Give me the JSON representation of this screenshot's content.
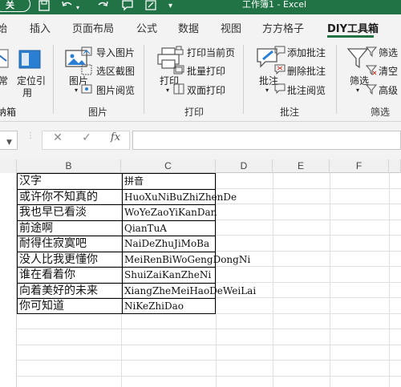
{
  "title_bar": {
    "autosave_label": "关",
    "document_title": "工作簿1 - Excel",
    "accent_color": "#217346",
    "icons": [
      "save-icon",
      "undo-icon",
      "redo-icon",
      "comment-icon",
      "dropdown-icon"
    ]
  },
  "tabs": [
    {
      "label": "始",
      "active": false
    },
    {
      "label": "插入",
      "active": false
    },
    {
      "label": "页面布局",
      "active": false
    },
    {
      "label": "公式",
      "active": false
    },
    {
      "label": "数据",
      "active": false
    },
    {
      "label": "视图",
      "active": false
    },
    {
      "label": "方方格子",
      "active": false
    },
    {
      "label": "DIY工具箱",
      "active": true
    }
  ],
  "ribbon": {
    "groups": {
      "g1": {
        "label": "纳箱",
        "btn1": "常",
        "btn2": "定位引",
        "btn2b": "用"
      },
      "images": {
        "label": "图片",
        "main_btn": "图片",
        "items": [
          "导入图片",
          "选区截图",
          "图片阅览"
        ]
      },
      "print": {
        "label": "打印",
        "main_btn": "打印",
        "items": [
          "打印当前页",
          "批量打印",
          "双面打印"
        ]
      },
      "comments": {
        "label": "批注",
        "main_btn": "批注",
        "items": [
          "添加批注",
          "删除批注",
          "批注阅览"
        ]
      },
      "filter": {
        "label": "筛选",
        "main_btn": "筛选",
        "items": [
          "筛选",
          "清空",
          "高级"
        ]
      }
    }
  },
  "formula_bar": {
    "cancel_symbol": "✕",
    "confirm_symbol": "✓",
    "fx_label": "fx",
    "formula_value": ""
  },
  "sheet": {
    "columns": [
      "B",
      "C",
      "D",
      "E",
      "F"
    ],
    "rows": [
      {
        "b": "汉字",
        "c": "拼音"
      },
      {
        "b": "或许你不知真的",
        "c": "HuoXuNiBuZhiZhenDe"
      },
      {
        "b": "我也早已看淡",
        "c": "WoYeZaoYiKanDan"
      },
      {
        "b": "前途啊",
        "c": "QianTuA"
      },
      {
        "b": "耐得住寂寞吧",
        "c": "NaiDeZhuJiMoBa"
      },
      {
        "b": "没人比我更懂你",
        "c": "MeiRenBiWoGengDongNi"
      },
      {
        "b": "谁在看着你",
        "c": "ShuiZaiKanZheNi"
      },
      {
        "b": "向着美好的未来",
        "c": "XiangZheMeiHaoDeWeiLai"
      },
      {
        "b": "你可知道",
        "c": "NiKeZhiDao"
      }
    ]
  }
}
